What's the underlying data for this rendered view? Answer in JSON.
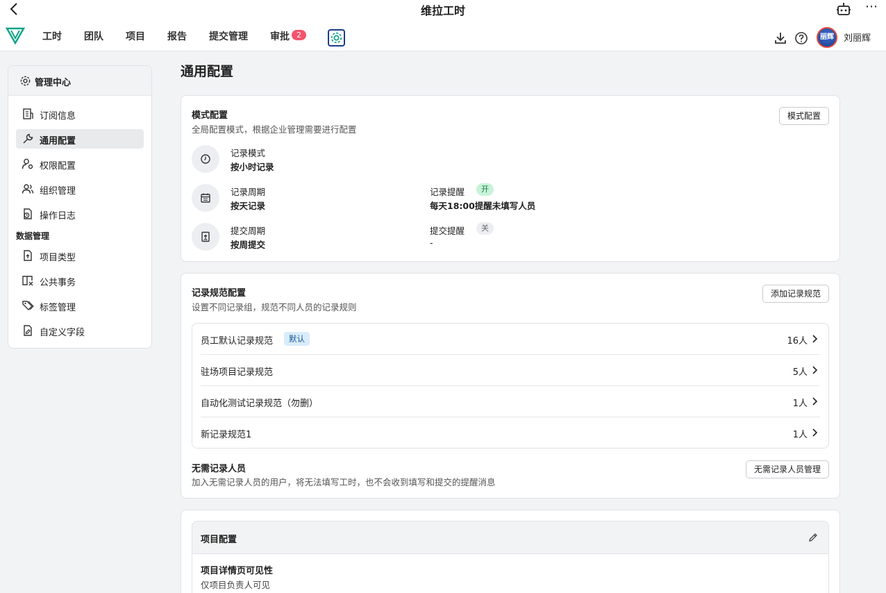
{
  "titlebar": {
    "title": "维拉工时"
  },
  "nav": {
    "items": [
      "工时",
      "团队",
      "项目",
      "报告",
      "提交管理",
      "审批"
    ],
    "approval_badge": "2",
    "username": "刘丽辉",
    "avatar_text": "丽辉"
  },
  "sidebar": {
    "header": "管理中心",
    "items": [
      "订阅信息",
      "通用配置",
      "权限配置",
      "组织管理",
      "操作日志"
    ],
    "group_label": "数据管理",
    "group_items": [
      "项目类型",
      "公共事务",
      "标签管理",
      "自定义字段"
    ],
    "active_index": 1
  },
  "main": {
    "page_title": "通用配置",
    "mode_card": {
      "title": "模式配置",
      "desc": "全局配置模式，根据企业管理需要进行配置",
      "button": "模式配置",
      "record_mode_label": "记录模式",
      "record_mode_value": "按小时记录",
      "record_cycle_label": "记录周期",
      "record_cycle_value": "按天记录",
      "record_reminder_label": "记录提醒",
      "record_reminder_status": "开",
      "record_reminder_value": "每天18:00提醒未填写人员",
      "submit_cycle_label": "提交周期",
      "submit_cycle_value": "按周提交",
      "submit_reminder_label": "提交提醒",
      "submit_reminder_status": "关",
      "submit_reminder_value": "-"
    },
    "rule_card": {
      "title": "记录规范配置",
      "desc": "设置不同记录组，规范不同人员的记录规则",
      "button": "添加记录规范",
      "rules": [
        {
          "name": "员工默认记录规范",
          "tag": "默认",
          "count": "16人"
        },
        {
          "name": "驻场项目记录规范",
          "tag": "",
          "count": "5人"
        },
        {
          "name": "自动化测试记录规范（勿删）",
          "tag": "",
          "count": "1人"
        },
        {
          "name": "新记录规范1",
          "tag": "",
          "count": "1人"
        }
      ],
      "exempt_title": "无需记录人员",
      "exempt_desc": "加入无需记录人员的用户，将无法填写工时，也不会收到填写和提交的提醒消息",
      "exempt_button": "无需记录人员管理"
    },
    "project_card": {
      "title": "项目配置",
      "visibility_label": "项目详情页可见性",
      "visibility_value": "仅项目负责人可见"
    }
  },
  "colors": {
    "accent": "#1a3c8e",
    "badge": "#f4546e",
    "on_tag": "#c8f3d8",
    "default_tag": "#d9ecfb"
  }
}
